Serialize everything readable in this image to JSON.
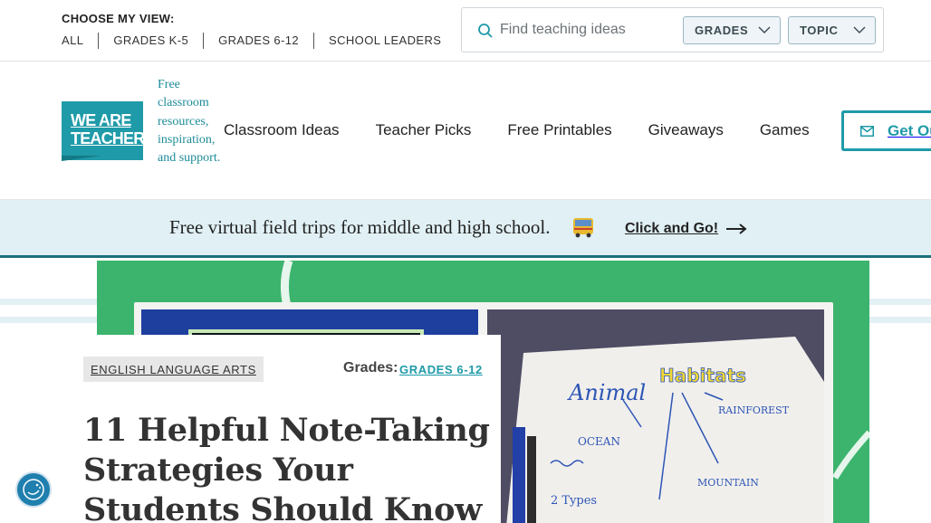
{
  "topbar": {
    "view_label": "CHOOSE MY VIEW:",
    "view_links": [
      "ALL",
      "GRADES K-5",
      "GRADES 6-12",
      "SCHOOL LEADERS"
    ],
    "search_placeholder": "Find teaching ideas",
    "grades_select": "GRADES",
    "topic_select": "TOPIC"
  },
  "header": {
    "logo_line1": "WE ARE",
    "logo_line2": "TEACHERS",
    "tagline": "Free classroom resources, inspiration, and support.",
    "nav": [
      "Classroom Ideas",
      "Teacher Picks",
      "Free Printables",
      "Giveaways",
      "Games"
    ],
    "cta": "Get Our"
  },
  "banner": {
    "text": "Free virtual field trips for middle and high school.",
    "cta": "Click and Go!"
  },
  "article": {
    "category": "ENGLISH LANGUAGE ARTS",
    "grades_label": "Grades:",
    "grades_value": "GRADES 6-12",
    "title": "11 Helpful Note-Taking Strategies Your Students Should Know"
  },
  "colors": {
    "brand_teal": "#1f9aa8",
    "hero_green": "#3cb46e",
    "banner_bg": "#e0f0f4"
  }
}
